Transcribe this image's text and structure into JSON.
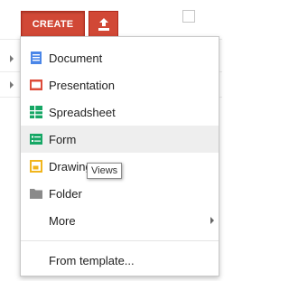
{
  "toolbar": {
    "create_label": "CREATE",
    "upload_icon": "upload-icon"
  },
  "menu": {
    "items": [
      {
        "label": "Document",
        "icon": "document-icon",
        "color": "#4a86e8"
      },
      {
        "label": "Presentation",
        "icon": "presentation-icon",
        "color": "#dd4b39"
      },
      {
        "label": "Spreadsheet",
        "icon": "spreadsheet-icon",
        "color": "#16a765"
      },
      {
        "label": "Form",
        "icon": "form-icon",
        "color": "#16a765"
      },
      {
        "label": "Drawing",
        "icon": "drawing-icon",
        "color": "#f1b51c"
      },
      {
        "label": "Folder",
        "icon": "folder-icon",
        "color": "#8a8a8a"
      },
      {
        "label": "More",
        "icon": "chevron-right-icon"
      }
    ],
    "template_label": "From template..."
  },
  "tooltip": {
    "text": "Views"
  }
}
